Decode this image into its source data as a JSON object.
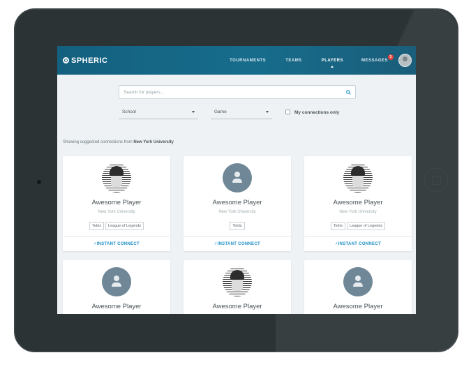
{
  "app": {
    "logo_text": "SPHERIC"
  },
  "nav": {
    "items": [
      {
        "label": "TOURNAMENTS"
      },
      {
        "label": "TEAMS"
      },
      {
        "label": "PLAYERS"
      },
      {
        "label": "MESSAGES"
      }
    ],
    "active": "PLAYERS",
    "messages_badge": "3"
  },
  "search": {
    "placeholder": "Search for players...",
    "value": ""
  },
  "filters": {
    "school": "School",
    "game": "Game",
    "connections_only_label": "My connections only",
    "connections_only_checked": false
  },
  "suggestion": {
    "prefix": "Showing suggested connections from",
    "school": "New York University"
  },
  "cards": [
    {
      "name": "Awesome Player",
      "school": "New York University",
      "tags": [
        "Tetris",
        "League of Legends"
      ],
      "action": "INSTANT CONNECT",
      "avatar": "photo"
    },
    {
      "name": "Awesome Player",
      "school": "New York University",
      "tags": [
        "Tetris"
      ],
      "action": "INSTANT CONNECT",
      "avatar": "default"
    },
    {
      "name": "Awesome Player",
      "school": "New York University",
      "tags": [
        "Tetris",
        "League of Legends"
      ],
      "action": "INSTANT CONNECT",
      "avatar": "photo"
    },
    {
      "name": "Awesome Player",
      "avatar": "default"
    },
    {
      "name": "Awesome Player",
      "avatar": "photo"
    },
    {
      "name": "Awesome Player",
      "avatar": "default"
    }
  ],
  "colors": {
    "nav_bg": "#176c8c",
    "accent": "#1c8fc6",
    "badge": "#e8413b",
    "page_bg": "#eef2f5"
  }
}
